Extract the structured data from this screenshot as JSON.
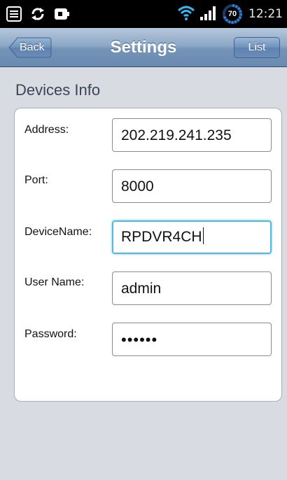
{
  "status_bar": {
    "icons_left": [
      "notification-icon",
      "sync-icon",
      "battery-saver-icon"
    ],
    "icons_right": [
      "wifi-icon",
      "signal-icon"
    ],
    "battery_level": "70",
    "time": "12:21"
  },
  "nav": {
    "back_label": "Back",
    "title": "Settings",
    "list_label": "List"
  },
  "section": {
    "title": "Devices Info"
  },
  "fields": {
    "address": {
      "label": "Address:",
      "value": "202.219.241.235"
    },
    "port": {
      "label": "Port:",
      "value": "8000"
    },
    "device_name": {
      "label": "DeviceName:",
      "value": "RPDVR4CH"
    },
    "user_name": {
      "label": "User Name:",
      "value": "admin"
    },
    "password": {
      "label": "Password:",
      "value": "••••••"
    }
  },
  "colors": {
    "nav_bar": "#7f9cc0",
    "content_background": "#d8dbe1",
    "focus_border": "#55b7e6",
    "battery_ring": "#2f7fd4"
  }
}
